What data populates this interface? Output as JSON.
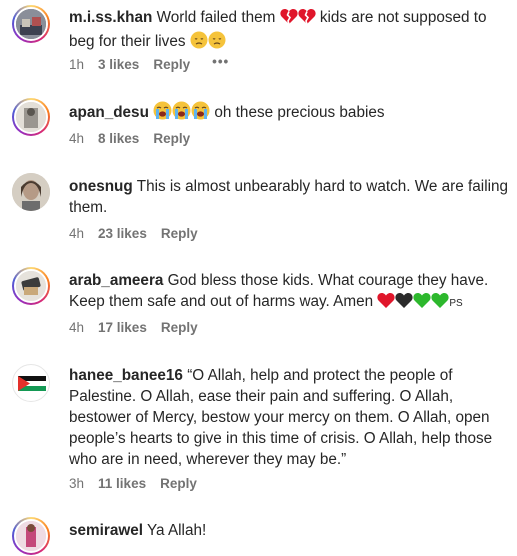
{
  "comments": [
    {
      "username": "m.i.ss.khan",
      "text_a": "World failed them",
      "text_b": "kids are not supposed to beg for their lives",
      "time": "1h",
      "likes": "3 likes",
      "reply": "Reply",
      "more": "•••"
    },
    {
      "username": "apan_desu",
      "text_a": "oh these precious babies",
      "time": "4h",
      "likes": "8 likes",
      "reply": "Reply"
    },
    {
      "username": "onesnug",
      "text_a": "This is almost unbearably hard to watch. We are failing them.",
      "time": "4h",
      "likes": "23 likes",
      "reply": "Reply"
    },
    {
      "username": "arab_ameera",
      "text_a": "God bless those kids. What courage they have. Keep them safe and out of harms way. Amen",
      "text_b": "PS",
      "time": "4h",
      "likes": "17 likes",
      "reply": "Reply"
    },
    {
      "username": "hanee_banee16",
      "text_a": "“O Allah, help and protect the people of Palestine. O Allah, ease their pain and suffering. O Allah, bestower of Mercy, bestow your mercy on them. O Allah, open people’s hearts to give in this time of crisis. O Allah, help those who are in need, wherever they may be.”",
      "time": "3h",
      "likes": "11 likes",
      "reply": "Reply"
    },
    {
      "username": "semirawel",
      "text_a": "Ya Allah!"
    }
  ],
  "icons": {
    "broken_heart": "broken-heart-icon",
    "disappointed_face": "disappointed-face-icon",
    "crying_face": "loudly-crying-face-icon",
    "red_heart": "red-heart-icon",
    "black_heart": "black-heart-icon",
    "green_heart": "green-heart-icon"
  },
  "colors": {
    "text": "#262626",
    "meta": "#737373",
    "heart_red": "#e0162b",
    "heart_black": "#2b2b2b",
    "heart_green": "#2db82d",
    "emoji_yellow": "#f5c33b"
  }
}
